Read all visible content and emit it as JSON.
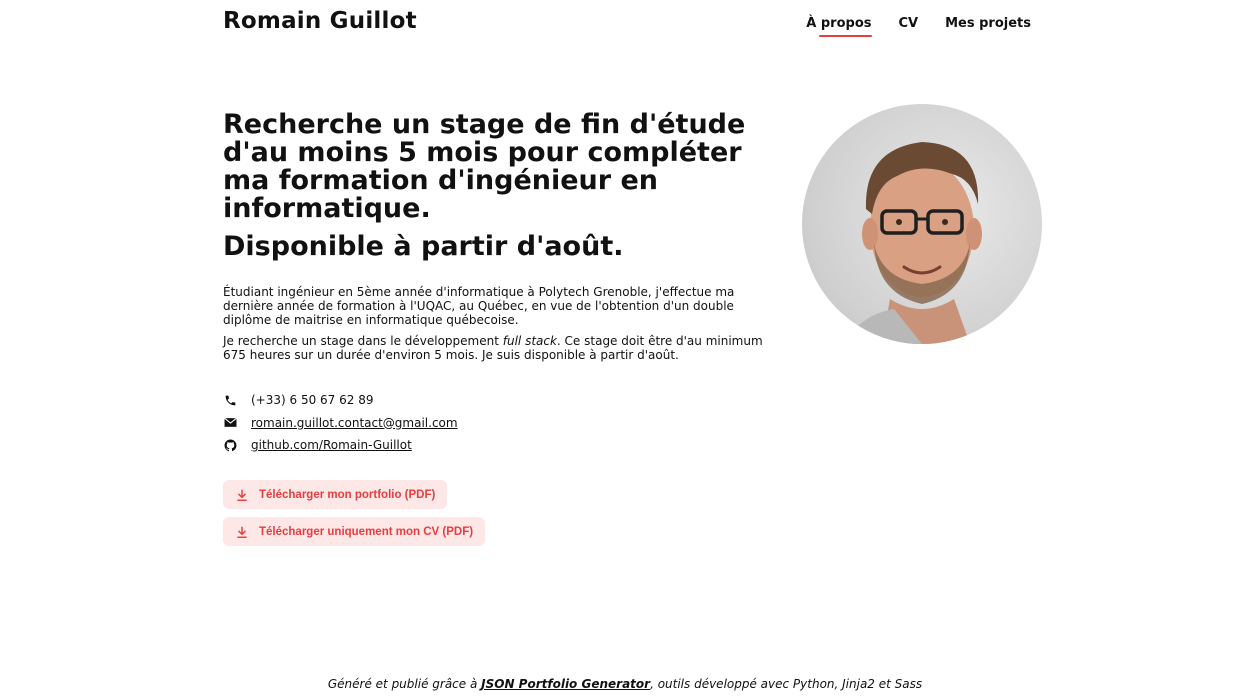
{
  "header": {
    "site_title": "Romain Guillot",
    "nav": [
      {
        "label": "À propos",
        "active": true
      },
      {
        "label": "CV",
        "active": false
      },
      {
        "label": "Mes projets",
        "active": false
      }
    ]
  },
  "hero": {
    "headline": "Recherche un stage de fin d'étude d'au moins 5 mois pour compléter ma formation d'ingénieur en informatique.",
    "availability": "Disponible à partir d'août."
  },
  "intro": {
    "paragraph1": "Étudiant ingénieur en 5ème année d'informatique à Polytech Grenoble, j'effectue ma dernière année de formation à l'UQAC, au Québec, en vue de l'obtention d'un double diplôme de maitrise en informatique québecoise.",
    "paragraph2_before": "Je recherche un stage dans le développement ",
    "paragraph2_em": "full stack",
    "paragraph2_after": ". Ce stage doit être d'au minimum 675 heures sur un durée d'environ 5 mois. Je suis disponible à partir d'août."
  },
  "contact": {
    "phone": "(+33) 6 50 67 62 89",
    "email": "romain.guillot.contact@gmail.com",
    "github": "github.com/Romain-Guillot"
  },
  "downloads": {
    "portfolio_label": "Télécharger mon portfolio (PDF)",
    "cv_label": "Télécharger uniquement mon CV (PDF)"
  },
  "icons": {
    "phone": "phone-icon",
    "email": "envelope-icon",
    "github": "github-icon",
    "download": "download-icon"
  },
  "colors": {
    "accent": "#e53e3e",
    "button_bg": "#fde7e7"
  },
  "footer": {
    "before": "Généré et publié grâce à ",
    "link": "JSON Portfolio Generator",
    "after": ", outils développé avec Python, Jinja2 et Sass"
  }
}
